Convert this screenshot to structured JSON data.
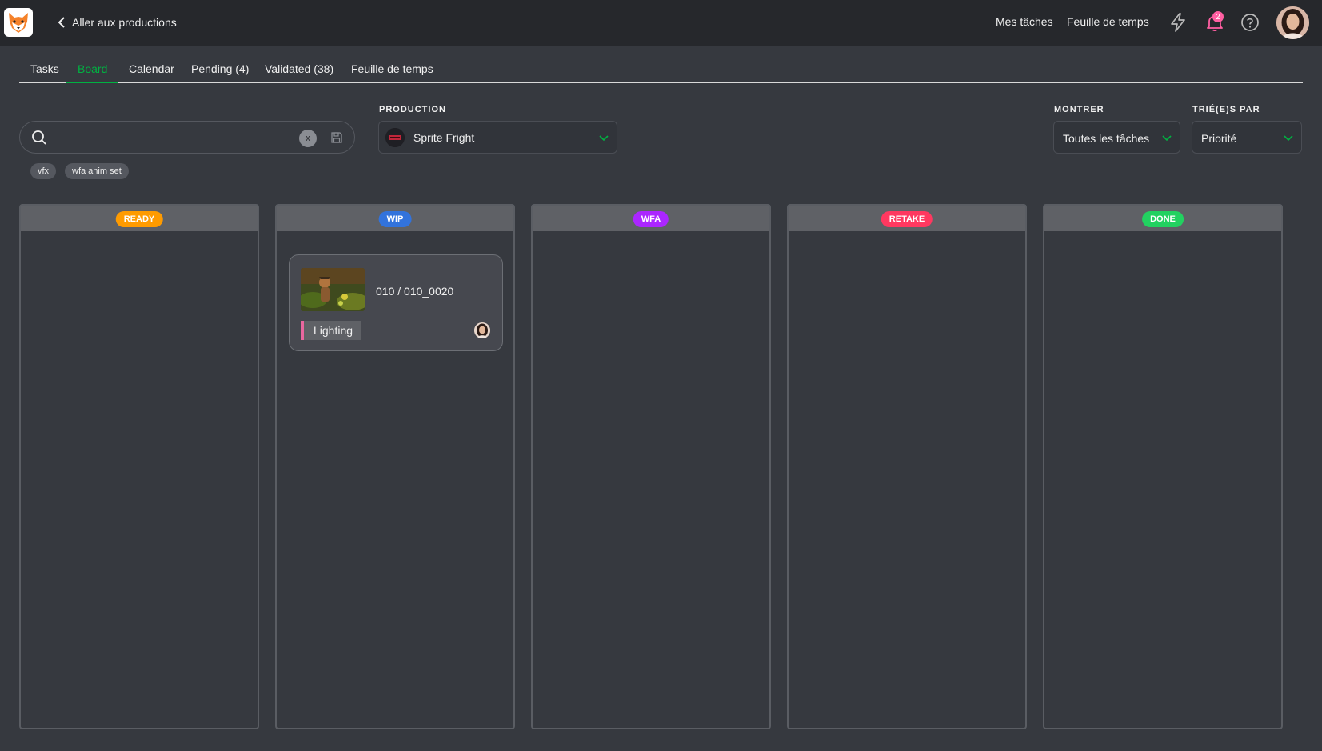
{
  "topbar": {
    "back_label": "Aller aux productions",
    "nav": [
      "Mes tâches",
      "Feuille de temps"
    ],
    "notification_count": "2",
    "icons": [
      "fox-logo-icon",
      "chevron-left-icon",
      "lightning-icon",
      "bell-icon",
      "help-icon",
      "user-avatar"
    ]
  },
  "tabs": [
    {
      "label": "Tasks",
      "active": false
    },
    {
      "label": "Board",
      "active": true
    },
    {
      "label": "Calendar",
      "active": false
    },
    {
      "label": "Pending (4)",
      "active": false
    },
    {
      "label": "Validated (38)",
      "active": false
    },
    {
      "label": "Feuille de temps",
      "active": false
    }
  ],
  "search": {
    "value": "",
    "placeholder": "",
    "clear_label": "x",
    "chips": [
      "vfx",
      "wfa anim set"
    ]
  },
  "filters": {
    "production_label": "PRODUCTION",
    "production_value": "Sprite Fright",
    "show_label": "MONTRER",
    "show_value": "Toutes les tâches",
    "sort_label": "TRIÉ(E)S PAR",
    "sort_value": "Priorité"
  },
  "columns": [
    {
      "status": "READY",
      "color": "#ff9b00"
    },
    {
      "status": "WIP",
      "color": "#3273dc"
    },
    {
      "status": "WFA",
      "color": "#ab26ff"
    },
    {
      "status": "RETAKE",
      "color": "#ff3860"
    },
    {
      "status": "DONE",
      "color": "#22d160"
    }
  ],
  "card": {
    "title": "010 / 010_0020",
    "task_type": "Lighting",
    "task_color": "#e9679f"
  },
  "colors": {
    "accent": "#00b242",
    "background": "#36393f",
    "topbar": "#26282c"
  }
}
